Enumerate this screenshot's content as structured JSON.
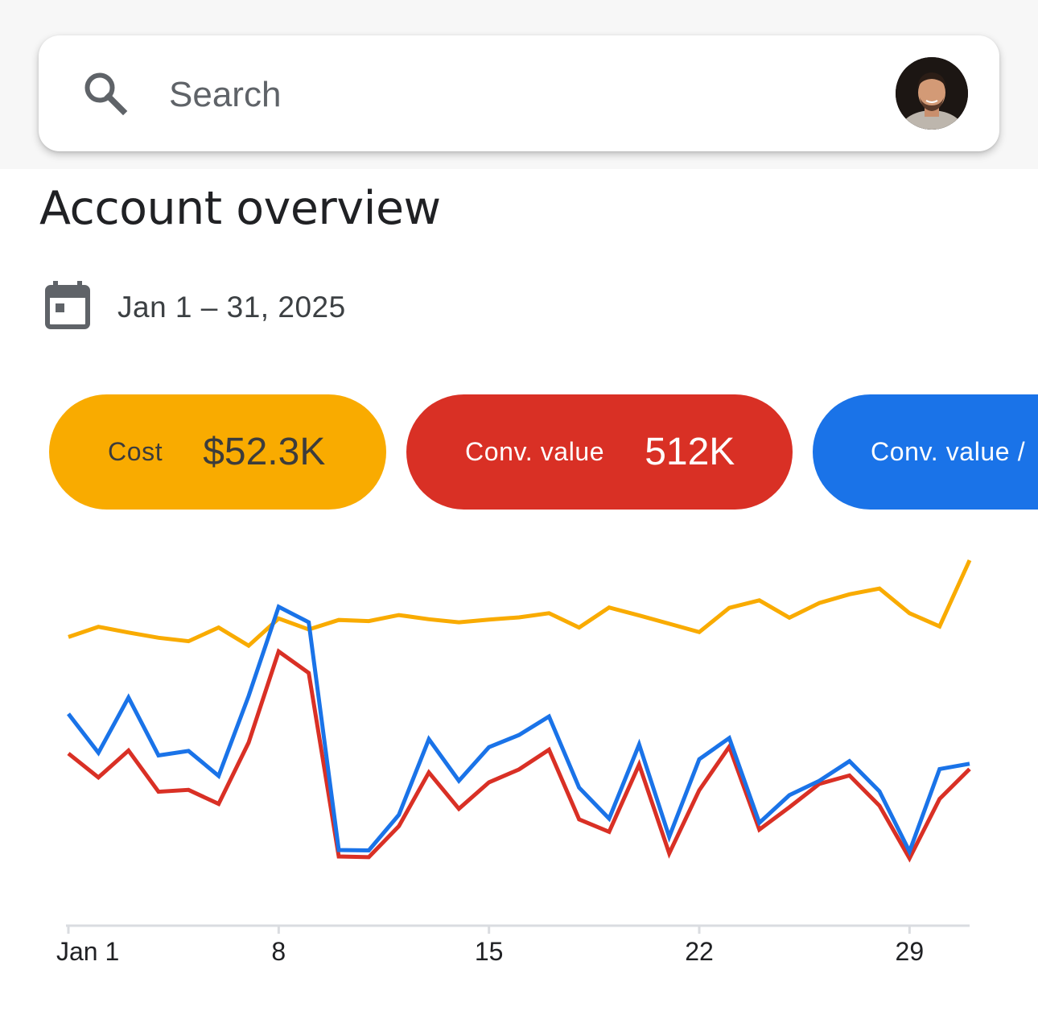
{
  "search": {
    "placeholder": "Search"
  },
  "page": {
    "title": "Account overview",
    "date_range": "Jan 1 – 31, 2025"
  },
  "metrics": [
    {
      "label": "Cost",
      "value": "$52.3K",
      "color": "#f9ab00"
    },
    {
      "label": "Conv. value",
      "value": "512K",
      "color": "#d93025"
    },
    {
      "label": "Conv. value /",
      "value": "",
      "color": "#1a73e8"
    }
  ],
  "icons": {
    "search": "search-icon",
    "calendar": "calendar-icon",
    "avatar": "user-avatar"
  },
  "chart_data": {
    "type": "line",
    "x": [
      1,
      2,
      3,
      4,
      5,
      6,
      7,
      8,
      9,
      10,
      11,
      12,
      13,
      14,
      15,
      16,
      17,
      18,
      19,
      20,
      21,
      22,
      23,
      24,
      25,
      26,
      27,
      28,
      29,
      30,
      31
    ],
    "x_tick_labels": [
      {
        "x": 1,
        "label": "Jan 1"
      },
      {
        "x": 8,
        "label": "8"
      },
      {
        "x": 15,
        "label": "15"
      },
      {
        "x": 22,
        "label": "22"
      },
      {
        "x": 29,
        "label": "29"
      }
    ],
    "xlim": [
      1,
      31
    ],
    "ylim": [
      0,
      100
    ],
    "grid": false,
    "legend": "none",
    "series": [
      {
        "color": "#f9ab00",
        "values": [
          76.3,
          79.0,
          77.5,
          76.1,
          75.2,
          78.8,
          74.0,
          81.2,
          78.3,
          80.8,
          80.5,
          82.1,
          81.0,
          80.2,
          80.9,
          81.5,
          82.6,
          78.8,
          84.1,
          82.0,
          79.8,
          77.6,
          84.0,
          86.0,
          81.4,
          85.3,
          87.6,
          89.1,
          82.6,
          79.1,
          96.6
        ]
      },
      {
        "color": "#d93025",
        "values": [
          45.5,
          39.2,
          46.3,
          35.4,
          35.9,
          32.2,
          48.4,
          72.5,
          66.8,
          18.3,
          18.1,
          26.3,
          40.5,
          30.9,
          37.9,
          41.3,
          46.5,
          28.1,
          24.8,
          42.6,
          19.1,
          35.8,
          47.3,
          25.4,
          31.3,
          37.5,
          39.7,
          31.7,
          17.8,
          33.5,
          41.4
        ]
      },
      {
        "color": "#1a73e8",
        "values": [
          56.0,
          45.7,
          60.3,
          45.0,
          46.2,
          39.6,
          60.7,
          84.3,
          80.2,
          20.0,
          19.9,
          29.3,
          49.3,
          38.3,
          47.2,
          50.4,
          55.3,
          36.5,
          28.3,
          47.9,
          23.5,
          44.0,
          49.6,
          27.2,
          34.5,
          38.3,
          43.5,
          35.5,
          19.6,
          41.4,
          42.8
        ]
      }
    ]
  }
}
